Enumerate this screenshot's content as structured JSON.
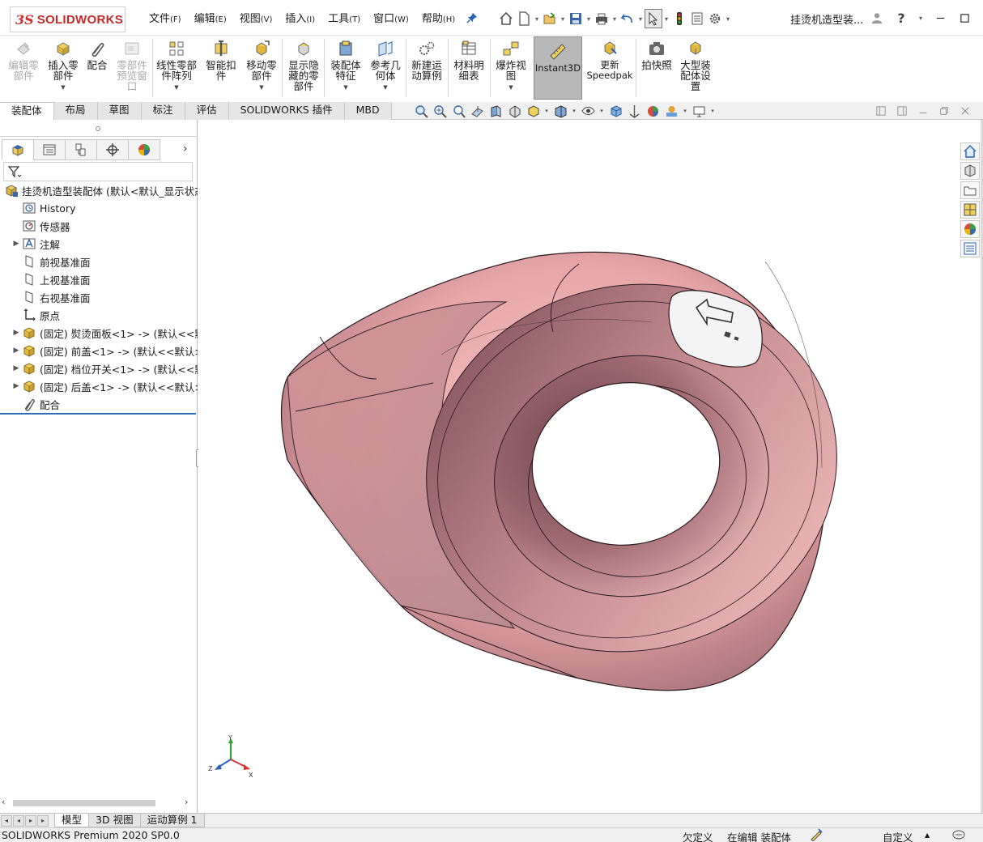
{
  "app": {
    "logo_ds": "3S",
    "logo_name": "SOLIDWORKS",
    "document_title": "挂烫机造型装..."
  },
  "menu": [
    {
      "label": "文件",
      "key": "(F)"
    },
    {
      "label": "编辑",
      "key": "(E)"
    },
    {
      "label": "视图",
      "key": "(V)"
    },
    {
      "label": "插入",
      "key": "(I)"
    },
    {
      "label": "工具",
      "key": "(T)"
    },
    {
      "label": "窗口",
      "key": "(W)"
    },
    {
      "label": "帮助",
      "key": "(H)"
    }
  ],
  "ribbon": {
    "edit_part": "编辑零\n部件",
    "insert_part": "插入零\n部件",
    "mate": "配合",
    "part_preview": "零部件\n预览窗\n口",
    "linear_pattern": "线性零部\n件阵列",
    "smart_fastener": "智能扣\n件",
    "move_part": "移动零\n部件",
    "show_hidden": "显示隐\n藏的零\n部件",
    "assembly_feature": "装配体\n特征",
    "ref_geometry": "参考几\n何体",
    "new_motion": "新建运\n动算例",
    "bom": "材料明\n细表",
    "exploded_view": "爆炸视\n图",
    "instant3d": "Instant3D",
    "update_speedpak": "更新\nSpeedpak",
    "snapshot": "拍快照",
    "large_assembly": "大型装\n配体设\n置"
  },
  "command_tabs": [
    "装配体",
    "布局",
    "草图",
    "标注",
    "评估",
    "SOLIDWORKS 插件",
    "MBD"
  ],
  "tree": {
    "root": "挂烫机造型装配体  (默认<默认_显示状态",
    "items": [
      {
        "label": "History",
        "icon": "history-icon",
        "expand": ""
      },
      {
        "label": "传感器",
        "icon": "sensor-icon",
        "expand": ""
      },
      {
        "label": "注解",
        "icon": "annotation-icon",
        "expand": "▶"
      },
      {
        "label": "前视基准面",
        "icon": "plane-icon",
        "expand": ""
      },
      {
        "label": "上视基准面",
        "icon": "plane-icon",
        "expand": ""
      },
      {
        "label": "右视基准面",
        "icon": "plane-icon",
        "expand": ""
      },
      {
        "label": "原点",
        "icon": "origin-icon",
        "expand": ""
      },
      {
        "label": "(固定) 熨烫面板<1> -> (默认<<默",
        "icon": "part-icon",
        "expand": "▶"
      },
      {
        "label": "(固定) 前盖<1> -> (默认<<默认>_",
        "icon": "part-icon",
        "expand": "▶"
      },
      {
        "label": "(固定) 档位开关<1> -> (默认<<默",
        "icon": "part-icon",
        "expand": "▶"
      },
      {
        "label": "(固定) 后盖<1> -> (默认<<默认>_",
        "icon": "part-icon",
        "expand": "▶"
      },
      {
        "label": "配合",
        "icon": "mates-icon",
        "expand": ""
      }
    ]
  },
  "bottom_tabs": [
    "模型",
    "3D 视图",
    "运动算例 1"
  ],
  "status": {
    "product": "SOLIDWORKS Premium 2020 SP0.0",
    "definition": "欠定义",
    "mode": "在编辑 装配体",
    "units": "自定义"
  },
  "triad": {
    "x": "X",
    "y": "Y",
    "z": "Z"
  },
  "colors": {
    "model_pink": "#e8a6a8",
    "ring_inner": "#8e5a63",
    "accent_blue": "#2f6fb5"
  }
}
